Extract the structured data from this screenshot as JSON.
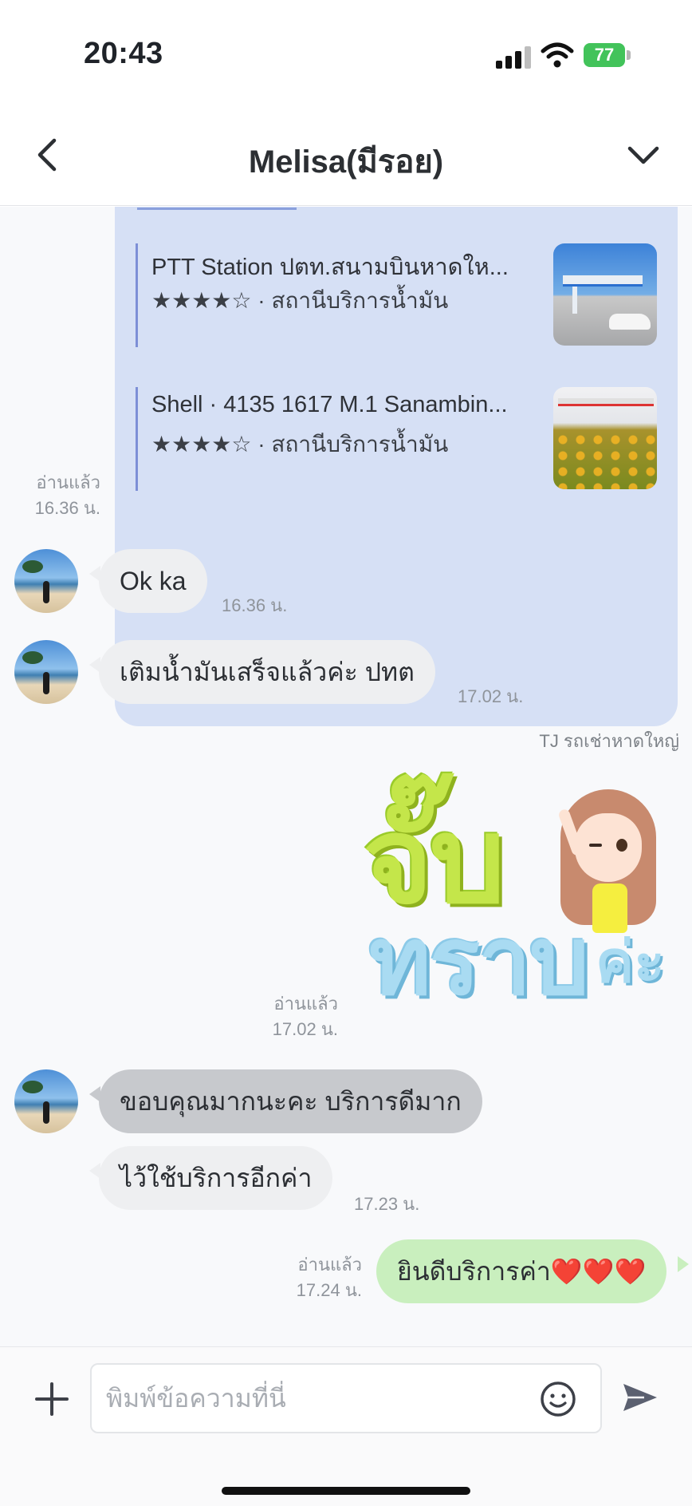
{
  "status_bar": {
    "time": "20:43",
    "battery": "77"
  },
  "header": {
    "title": "Melisa(มีรอย)"
  },
  "shared_places": [
    {
      "name": "PTT Station ปตท.สนามบินหาดให...",
      "rating": "★★★★☆ · สถานีบริการน้ำมัน"
    },
    {
      "name": "Shell · 4135 1617 M.1 Sanambin...",
      "rating": "★★★★☆ · สถานีบริการน้ำมัน"
    }
  ],
  "stamps": {
    "card": {
      "read": "อ่านแล้ว",
      "time": "16.36 น."
    },
    "sticker": {
      "read": "อ่านแล้ว",
      "time": "17.02 น."
    },
    "last": {
      "read": "อ่านแล้ว",
      "time": "17.24 น."
    }
  },
  "messages": [
    {
      "text": "Ok ka",
      "time": "16.36 น."
    },
    {
      "text": "เติมน้ำมันเสร็จแล้วค่ะ ปทต",
      "time": "17.02 น."
    },
    {
      "text": "ขอบคุณมากนะคะ บริการดีมาก",
      "time": ""
    },
    {
      "text": "ไว้ใช้บริการอีกค่า",
      "time": "17.23 น."
    },
    {
      "text": "ยินดีบริการค่า❤️❤️❤️",
      "time": ""
    }
  ],
  "sender_name": "TJ รถเช่าหาดใหญ่",
  "sticker": {
    "line1": "จั๊บ",
    "line2": "ทราบ",
    "line3": "ค่ะ"
  },
  "composer": {
    "placeholder": "พิมพ์ข้อความที่นี่"
  },
  "colors": {
    "out_bubble": "#c9efbe",
    "in_bubble": "#eeeff1",
    "card": "#d6e0f5"
  }
}
